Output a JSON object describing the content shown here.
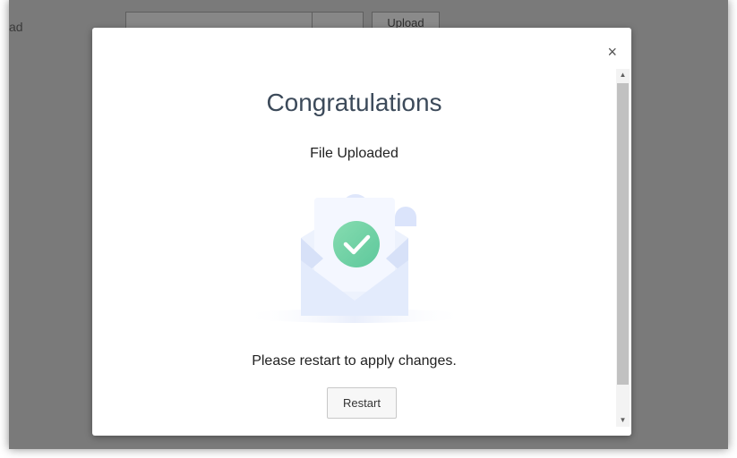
{
  "background": {
    "label": "ad",
    "select_value": "",
    "upload_button": "Upload"
  },
  "modal": {
    "close_glyph": "×",
    "title": "Congratulations",
    "subtitle": "File Uploaded",
    "message": "Please restart to apply changes.",
    "restart_label": "Restart",
    "illustration_icon": "envelope-check-icon"
  },
  "colors": {
    "accent_green": "#6bd2a4",
    "envelope": "#e6edfb",
    "title_color": "#3c4a5a"
  }
}
